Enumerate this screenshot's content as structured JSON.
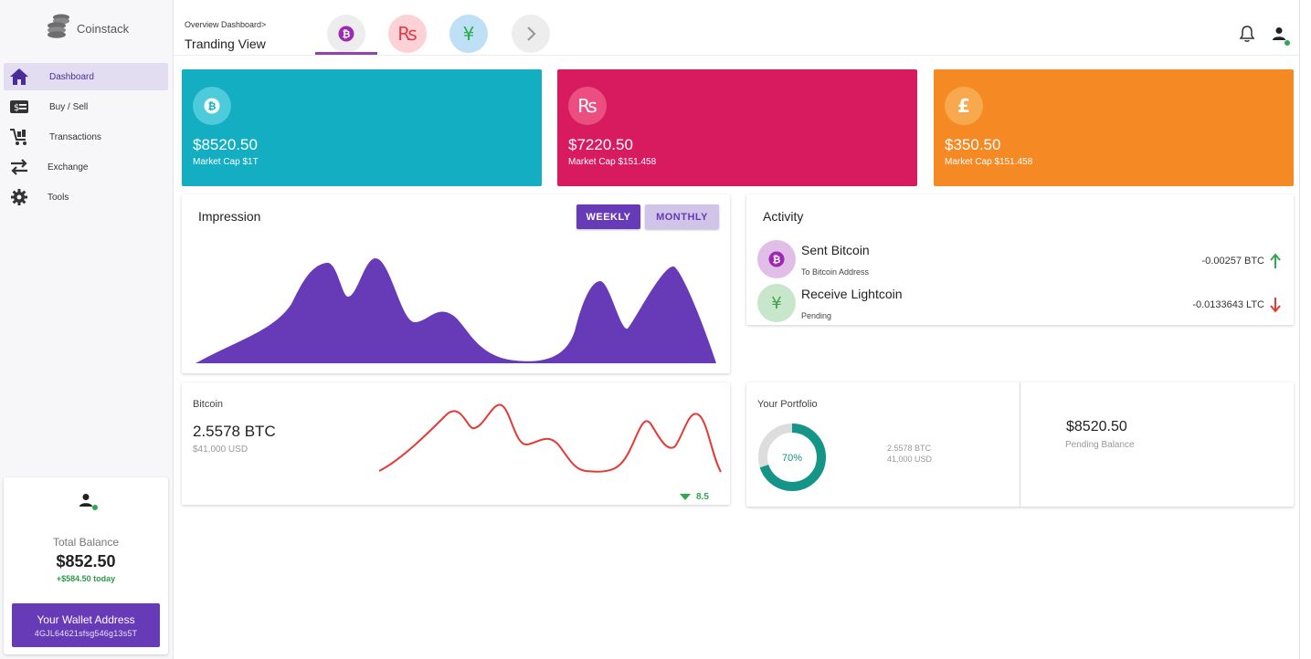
{
  "brand": {
    "name": "Coinstack"
  },
  "sidebar": {
    "items": [
      {
        "label": "Dashboard",
        "icon": "home-icon",
        "active": true
      },
      {
        "label": "Buy / Sell",
        "icon": "cash-icon",
        "active": false
      },
      {
        "label": "Transactions",
        "icon": "cart-icon",
        "active": false
      },
      {
        "label": "Exchange",
        "icon": "swap-icon",
        "active": false
      },
      {
        "label": "Tools",
        "icon": "gear-icon",
        "active": false
      }
    ],
    "balance": {
      "label": "Total Balance",
      "value": "$852.50",
      "today": "+$584.50 today",
      "wallet_title": "Your Wallet Address",
      "wallet_address": "4GJL64621sfsg546g13s5T"
    }
  },
  "header": {
    "breadcrumb": "Overview Dashboard>",
    "title": "Tranding View",
    "tabs": [
      {
        "glyph": "₿",
        "icon": "bitcoin-icon",
        "bg": "#ededed",
        "fg": "#9b2bb0"
      },
      {
        "glyph": "₨",
        "icon": "rupee-icon",
        "bg": "#fdd2d6",
        "fg": "#e53949"
      },
      {
        "glyph": "¥",
        "icon": "yen-icon",
        "bg": "#bde0f7",
        "fg": "#2ea84f"
      },
      {
        "glyph": "›",
        "icon": "chevron-right-icon",
        "bg": "#ededed",
        "fg": "#999999"
      }
    ]
  },
  "coins": [
    {
      "glyph": "₿",
      "price": "$8520.50",
      "cap": "Market Cap $1T",
      "bg": "#13aec2",
      "circle": "#4ecbda"
    },
    {
      "glyph": "₨",
      "price": "$7220.50",
      "cap": "Market Cap $151.458",
      "bg": "#d81b5e",
      "circle": "#ea4f80"
    },
    {
      "glyph": "£",
      "price": "$350.50",
      "cap": "Market Cap $151.458",
      "bg": "#f58a25",
      "circle": "#f8a94e"
    }
  ],
  "impression": {
    "title": "Impression",
    "weekly": "WEEKLY",
    "monthly": "MONTHLY",
    "accent": "#673ab7"
  },
  "activity": {
    "title": "Activity",
    "items": [
      {
        "name": "Sent Bitcoin",
        "sub": "To Bitcoin Address",
        "amount": "-0.00257 BTC",
        "direction": "up",
        "glyph": "₿",
        "bg": "#e1bee7",
        "fg": "#9c27b0"
      },
      {
        "name": "Receive Lightcoin",
        "sub": "Pending",
        "amount": "-0.0133643 LTC",
        "direction": "down",
        "glyph": "¥",
        "bg": "#c8e6c9",
        "fg": "#43a047"
      }
    ]
  },
  "bitcoin": {
    "label": "Bitcoin",
    "amount": "2.5578 BTC",
    "usd": "$41,000 USD",
    "change": "8.5",
    "line_color": "#e53935"
  },
  "portfolio": {
    "title": "Your Portfolio",
    "percent": 70,
    "percent_label": "70%",
    "btc": "2.5578 BTC",
    "usd": "41,000 USD",
    "pending_value": "$8520.50",
    "pending_label": "Pending Balance",
    "ring_color": "#159488"
  }
}
